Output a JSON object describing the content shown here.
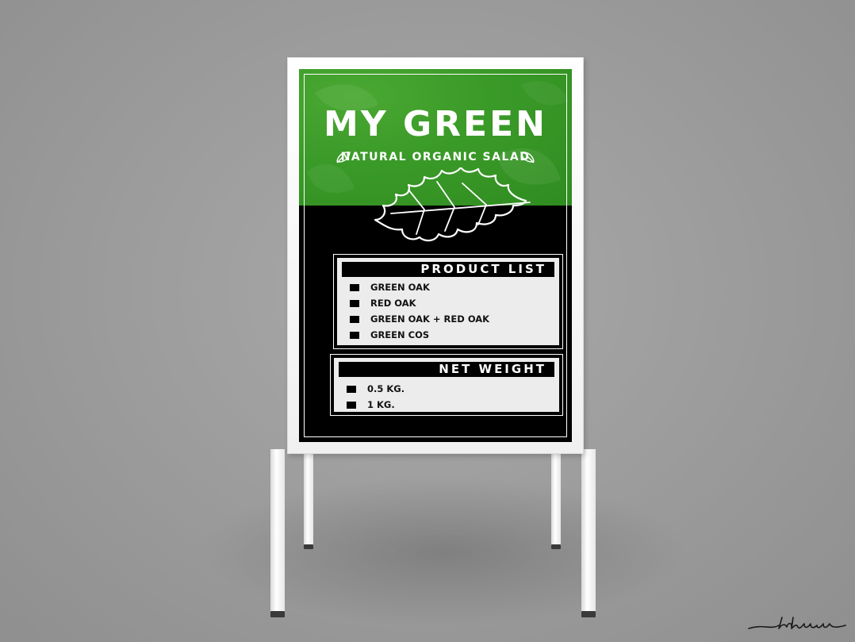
{
  "sign": {
    "title": "MY GREEN",
    "subtitle": "NATURAL ORGANIC SALAD",
    "product_header": "PRODUCT LIST",
    "products": [
      "GREEN OAK",
      "RED OAK",
      "GREEN OAK + RED OAK",
      "GREEN COS"
    ],
    "weight_header": "NET WEIGHT",
    "weights": [
      "0.5 KG.",
      "1 KG."
    ]
  },
  "signature": "taluew",
  "colors": {
    "background": "#9b9b9b",
    "frame": "#ffffff",
    "poster_green": "#3a9a28",
    "poster_black": "#000000",
    "list_box": "#ececec"
  },
  "icons": [
    "oak-leaf-icon",
    "small-leaf-icon",
    "bullet-square-icon"
  ]
}
